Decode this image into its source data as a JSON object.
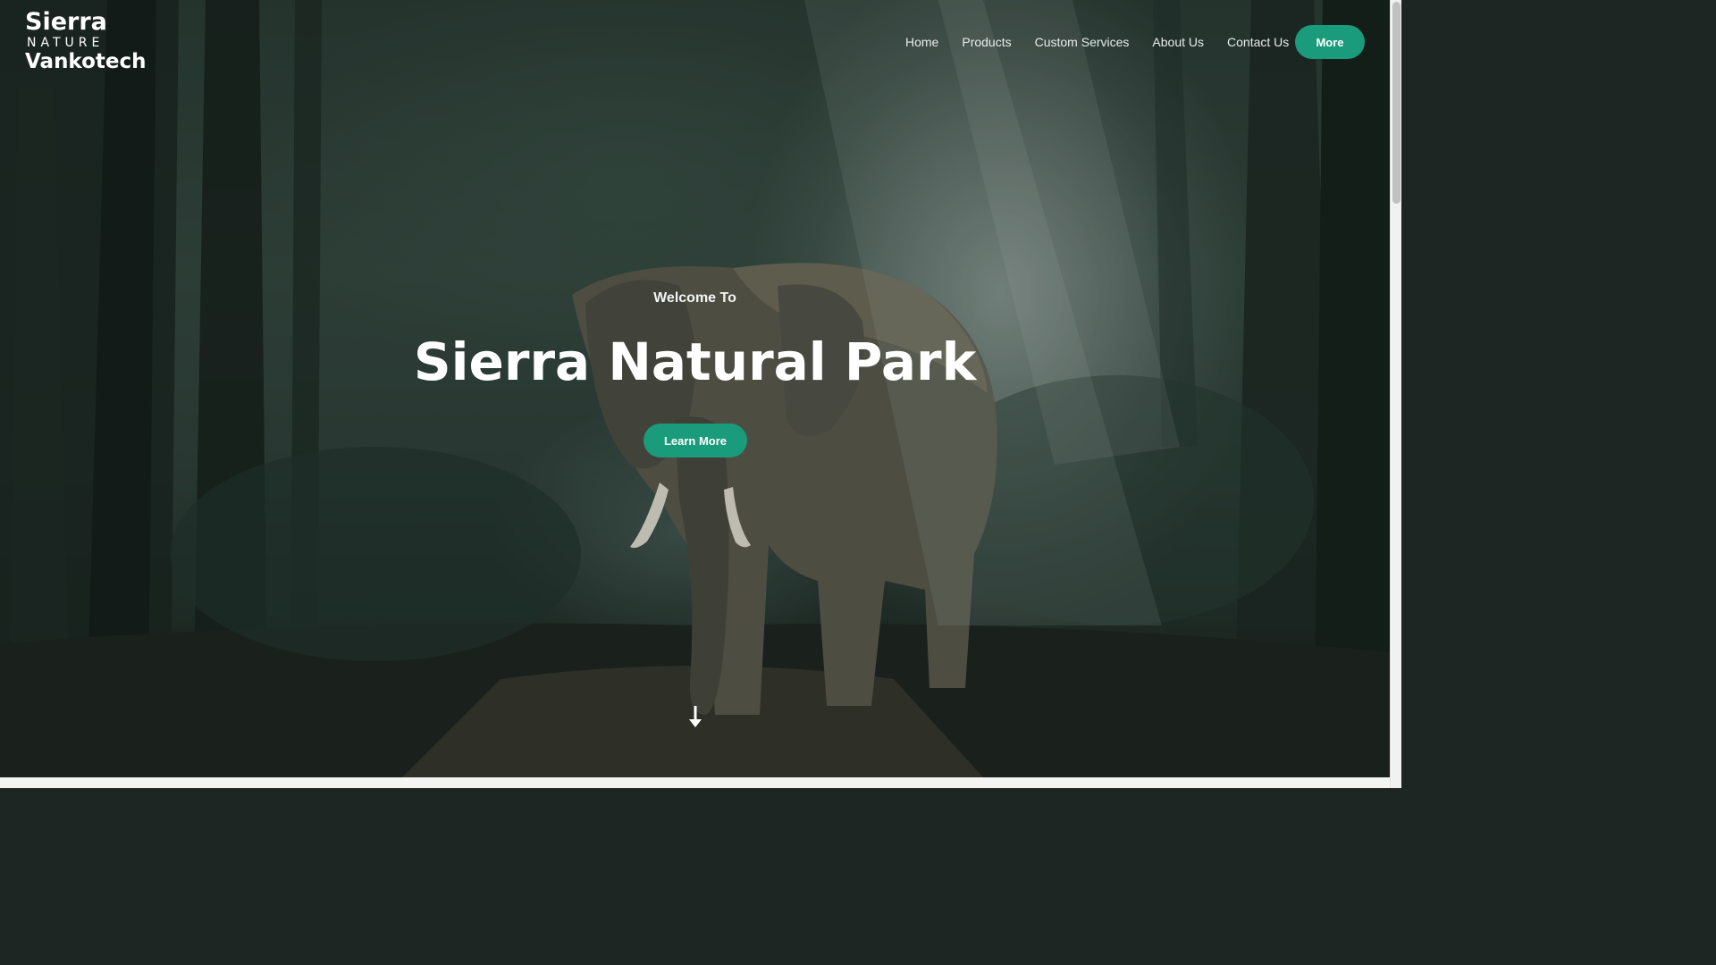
{
  "brand": {
    "line1": "Sierra",
    "line2": "NATURE",
    "line3": "Vankotech"
  },
  "nav": {
    "items": [
      {
        "label": "Home"
      },
      {
        "label": "Products"
      },
      {
        "label": "Custom Services"
      },
      {
        "label": "About Us"
      },
      {
        "label": "Contact Us"
      }
    ],
    "more_label": "More"
  },
  "hero": {
    "kicker": "Welcome To",
    "title": "Sierra Natural Park",
    "cta_label": "Learn More",
    "scroll_icon": "arrow-down-icon"
  },
  "colors": {
    "accent": "#1a9b7b",
    "text": "#ffffff"
  }
}
